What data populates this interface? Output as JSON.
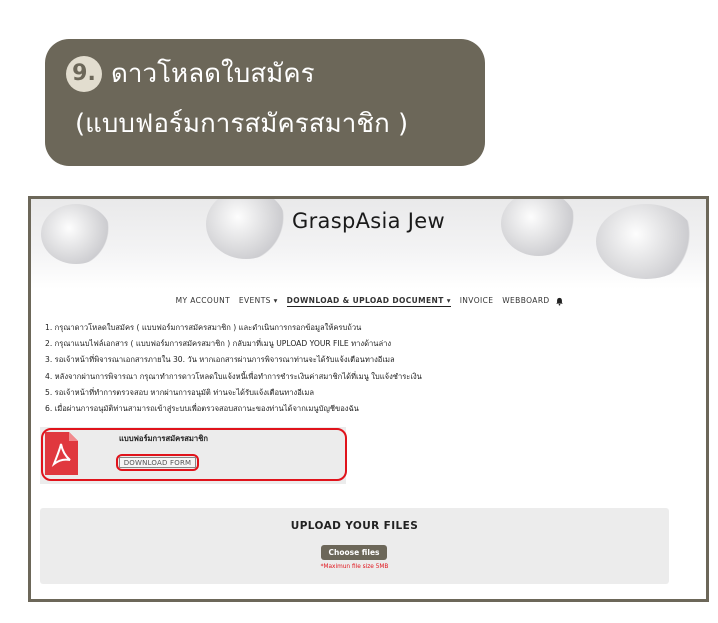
{
  "step": {
    "number": "9.",
    "title": "ดาวโหลดใบสมัคร",
    "subtitle": "(แบบฟอร์มการสมัครสมาชิก )"
  },
  "site": {
    "brand": "GraspAsia Jew"
  },
  "nav": {
    "items": [
      {
        "label": "MY ACCOUNT"
      },
      {
        "label": "EVENTS ▾"
      },
      {
        "label": "DOWNLOAD & UPLOAD DOCUMENT ▾",
        "active": true
      },
      {
        "label": "INVOICE"
      },
      {
        "label": "WEBBOARD"
      }
    ],
    "bell_icon": "bell-icon"
  },
  "instructions": [
    "1. กรุณาดาวโหลดใบสมัคร ( แบบฟอร์มการสมัครสมาชิก ) และดำเนินการกรอกข้อมูลให้ครบถ้วน",
    "2. กรุณาแนบไฟล์เอกสาร ( แบบฟอร์มการสมัครสมาชิก ) กลับมาที่เมนู UPLOAD YOUR FILE ทางด้านล่าง",
    "3. รอเจ้าหน้าที่พิจารณาเอกสารภายใน 30. วัน หากเอกสารผ่านการพิจารณาท่านจะได้รับแจ้งเตือนทางอีเมล",
    "4. หลังจากผ่านการพิจารณา กรุณาทำการดาวโหลดใบแจ้งหนี้เพื่อทำการชำระเงินค่าสมาชิกได้ที่เมนู ใบแจ้งชำระเงิน",
    "5. รอเจ้าหน้าที่ทำการตรวจสอบ หากผ่านการอนุมัติ ท่านจะได้รับแจ้งเตือนทางอีเมล",
    "6. เมื่อผ่านการอนุมัติท่านสามารถเข้าสู่ระบบเพื่อตรวจสอบสถานะของท่านได้จากเมนูบัญชีของฉัน"
  ],
  "download": {
    "form_title": "แบบฟอร์มการสมัครสมาชิก",
    "button_label": "DOWNLOAD FORM",
    "icon": "pdf-icon"
  },
  "upload": {
    "title": "UPLOAD YOUR FILES",
    "button_label": "Choose files",
    "note": "*Maximun file size 5MB"
  },
  "colors": {
    "banner": "#6c6759",
    "highlight": "#e0131b",
    "pdf": "#e0383e"
  }
}
